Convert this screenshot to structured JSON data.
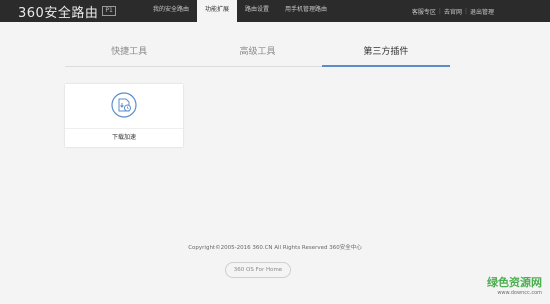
{
  "header": {
    "logo_text": "360安全路由",
    "logo_badge": "P1",
    "nav": [
      "我的安全路由",
      "功能扩展",
      "路由设置",
      "用手机管理路由"
    ],
    "active_nav": 1,
    "right_links": [
      "客服专区",
      "去官网",
      "退出管理"
    ],
    "right_sep": "|"
  },
  "tabs": {
    "items": [
      "快捷工具",
      "高级工具",
      "第三方插件"
    ],
    "active": 2
  },
  "plugins": [
    {
      "label": "下载加速",
      "icon": "download-accelerate-icon"
    }
  ],
  "footer": {
    "copyright": "Copyright©2005-2016 360.CN All Rights Reserved 360安全中心",
    "os_button": "360 OS For Home"
  },
  "watermark": {
    "main": "绿色资源网",
    "sub": "www.downcc.com"
  },
  "colors": {
    "accent": "#5b8dc9",
    "topbar": "#2b2b2b"
  }
}
